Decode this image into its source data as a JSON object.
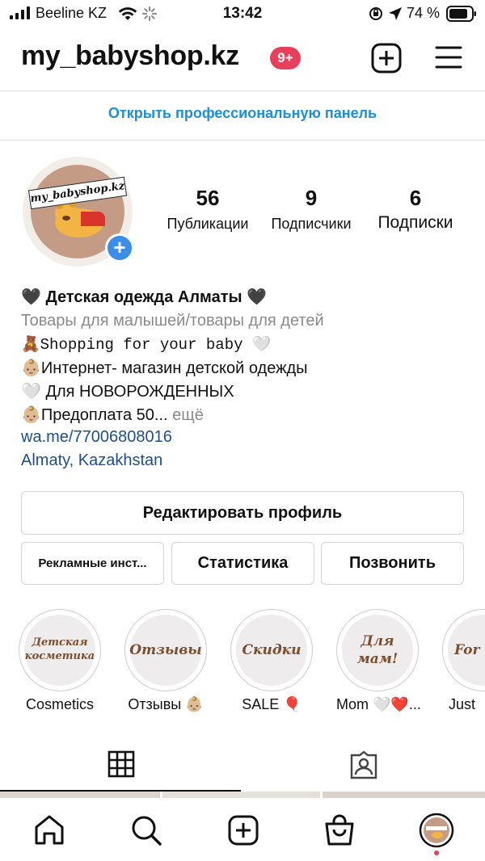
{
  "status_bar": {
    "carrier": "Beeline KZ",
    "time": "13:42",
    "battery": "74 %"
  },
  "header": {
    "username": "my_babyshop.kz",
    "notification_badge": "9+"
  },
  "pro_panel": "Открыть профессиональную панель",
  "avatar_text": "my_babyshop.kz",
  "stats": [
    {
      "count": "56",
      "label": "Публикации"
    },
    {
      "count": "9",
      "label": "Подписчики"
    },
    {
      "count": "6",
      "label": "Подписки"
    }
  ],
  "bio": {
    "name": "🖤 Детская одежда Алматы 🖤",
    "category": "Товары для малышей/товары для детей",
    "line1": "🧸Shopping for your baby 🤍",
    "line2": "👶🏼Интернет- магазин детской одежды",
    "line3": "🤍 Для НОВОРОЖДЕННЫХ",
    "line4": "👶🏼Предоплата 50...",
    "more": "ещё",
    "link": "wa.me/77006808016",
    "location": "Almaty, Kazakhstan"
  },
  "buttons": {
    "edit": "Редактировать профиль",
    "ads": "Рекламные инст...",
    "stats": "Статистика",
    "call": "Позвонить"
  },
  "highlights": [
    {
      "cover": "Детская косметика",
      "caption": "Cosmetics"
    },
    {
      "cover": "Отзывы",
      "caption": "Отзывы 👶🏼"
    },
    {
      "cover": "Скидки",
      "caption": "SALE 🎈"
    },
    {
      "cover": "Для мам!",
      "caption": "Mom 🤍❤️..."
    },
    {
      "cover": "For",
      "caption": "Just"
    }
  ],
  "colors": {
    "accent": "#1c8fd8",
    "badge": "#e8405a",
    "link": "#1c4f8c",
    "add_story": "#3b8ee8"
  },
  "icons": [
    "signal-icon",
    "wifi-icon",
    "loading-icon",
    "orientation-lock-icon",
    "location-arrow-icon",
    "battery-icon",
    "new-post-icon",
    "menu-icon",
    "grid-icon",
    "tagged-icon",
    "home-icon",
    "search-icon",
    "create-icon",
    "shop-icon",
    "profile-avatar-icon"
  ]
}
